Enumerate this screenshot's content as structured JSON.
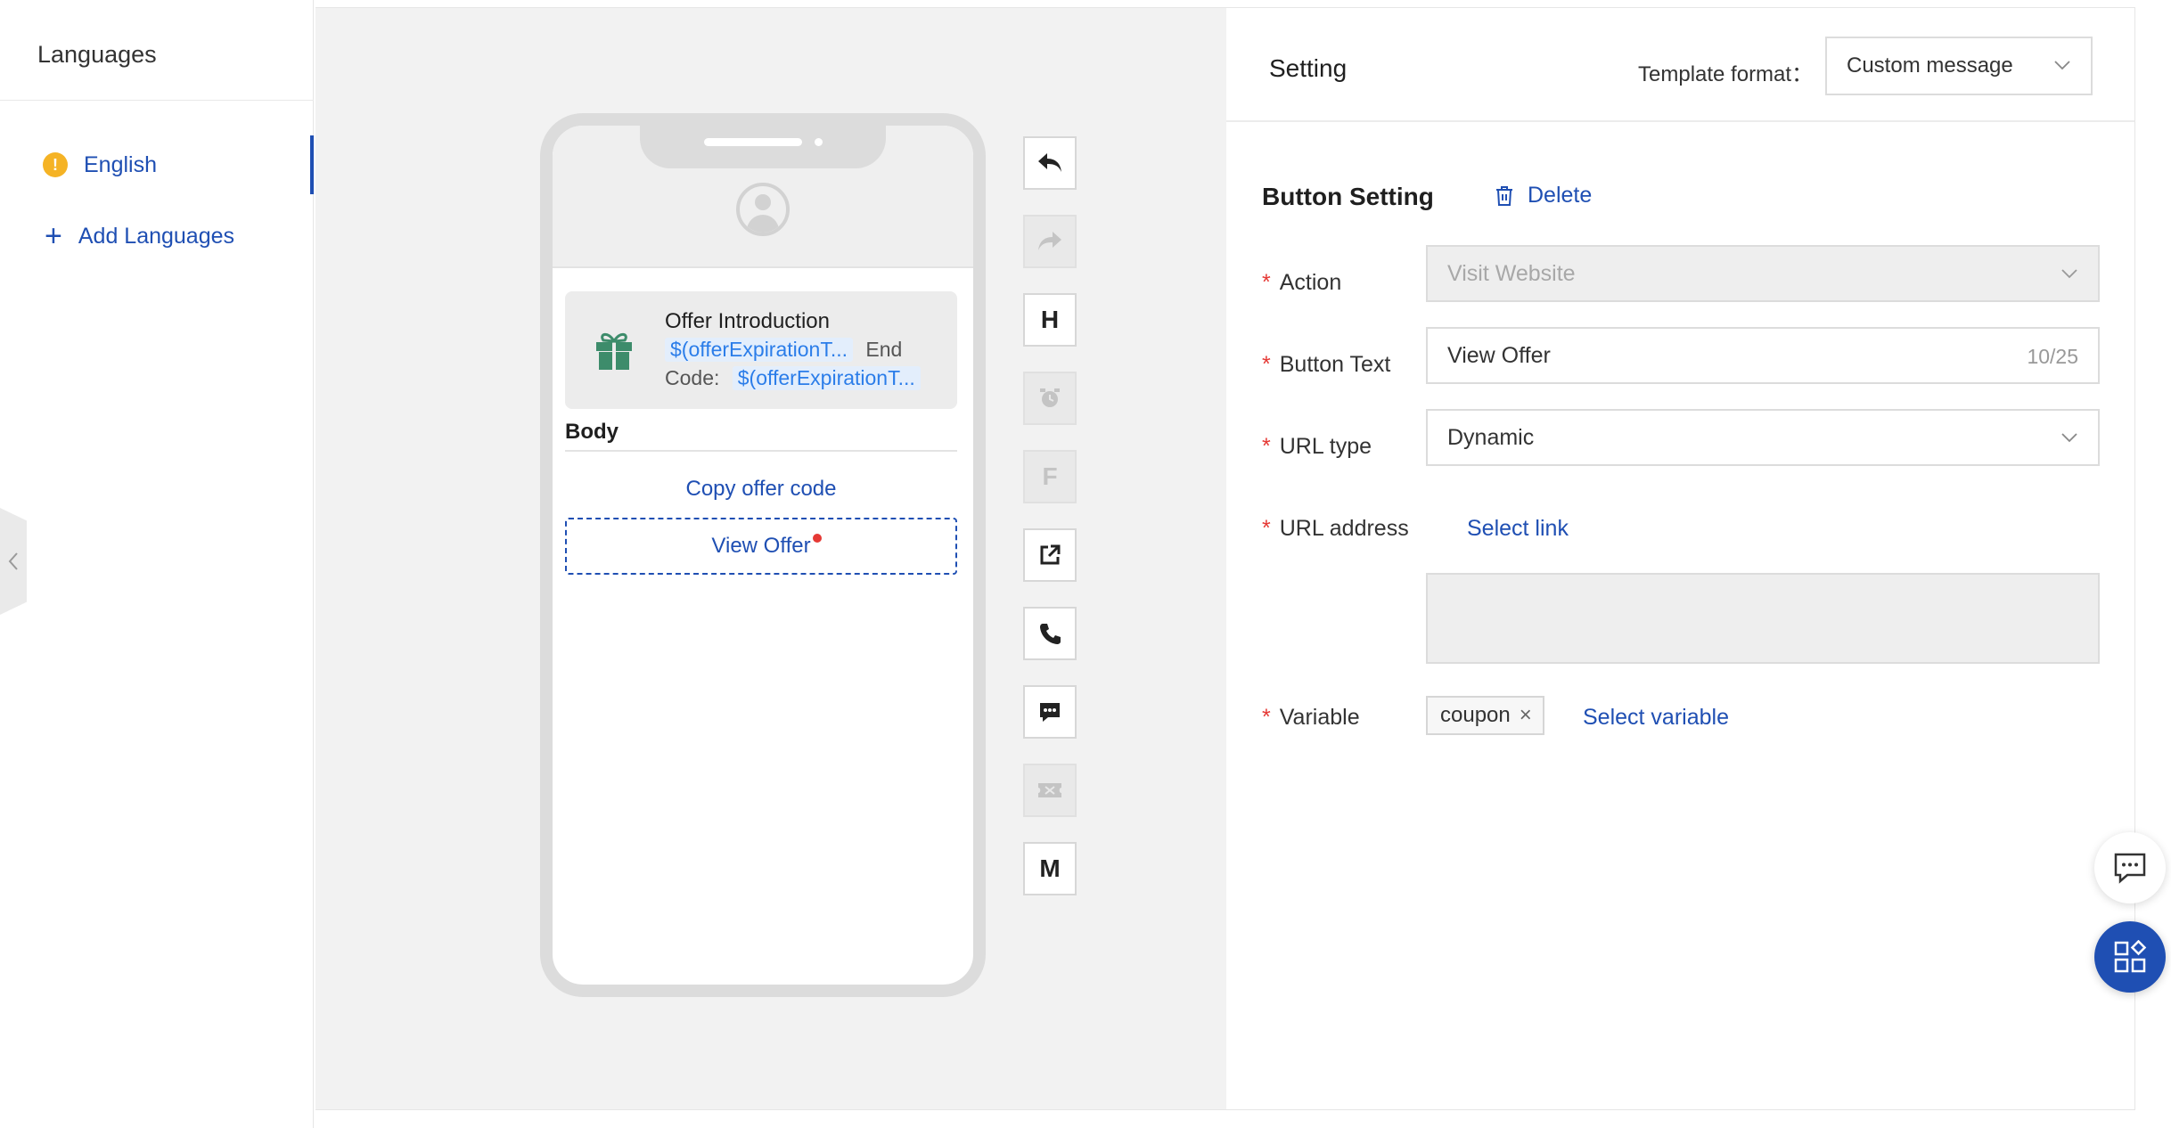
{
  "languages_panel": {
    "title": "Languages",
    "items": [
      {
        "label": "English",
        "warning_badge": "!",
        "status": "warning"
      }
    ],
    "add_label": "Add Languages",
    "add_icon": "+"
  },
  "preview": {
    "offer_title": "Offer Introduction",
    "line1_var": "$(offerExpirationT...",
    "line1_suffix": "End",
    "line2_prefix": "Code:",
    "line2_var": "$(offerExpirationT...",
    "body_label": "Body",
    "copy_button_label": "Copy offer code",
    "view_button_label": "View Offer",
    "toolbar": [
      {
        "name": "reply-icon",
        "label": "",
        "disabled": false
      },
      {
        "name": "forward-icon",
        "label": "",
        "disabled": true
      },
      {
        "name": "header-icon",
        "label": "H",
        "disabled": false
      },
      {
        "name": "alarm-icon",
        "label": "",
        "disabled": true
      },
      {
        "name": "footer-icon",
        "label": "F",
        "disabled": true
      },
      {
        "name": "external-link-icon",
        "label": "",
        "disabled": false
      },
      {
        "name": "phone-icon",
        "label": "",
        "disabled": false
      },
      {
        "name": "quick-reply-icon",
        "label": "",
        "disabled": false
      },
      {
        "name": "coupon-icon",
        "label": "",
        "disabled": true
      },
      {
        "name": "media-icon",
        "label": "M",
        "disabled": false
      }
    ]
  },
  "settings": {
    "title": "Setting",
    "template_format_label": "Template format：",
    "template_format_value": "Custom message",
    "section_title": "Button Setting",
    "delete_label": "Delete",
    "action_label": "Action",
    "action_value": "Visit Website",
    "button_text_label": "Button Text",
    "button_text_value": "View Offer",
    "button_text_counter": "10/25",
    "url_type_label": "URL type",
    "url_type_value": "Dynamic",
    "url_address_label": "URL address",
    "select_link_label": "Select link",
    "variable_label": "Variable",
    "variable_tag": "coupon",
    "select_variable_label": "Select variable",
    "required_mark": "*"
  },
  "colors": {
    "accent": "#1f4fb3",
    "required": "#e53935",
    "warning": "#f5b325",
    "gift": "#3d8c6b",
    "variable_chip_text": "#2b7de9"
  }
}
